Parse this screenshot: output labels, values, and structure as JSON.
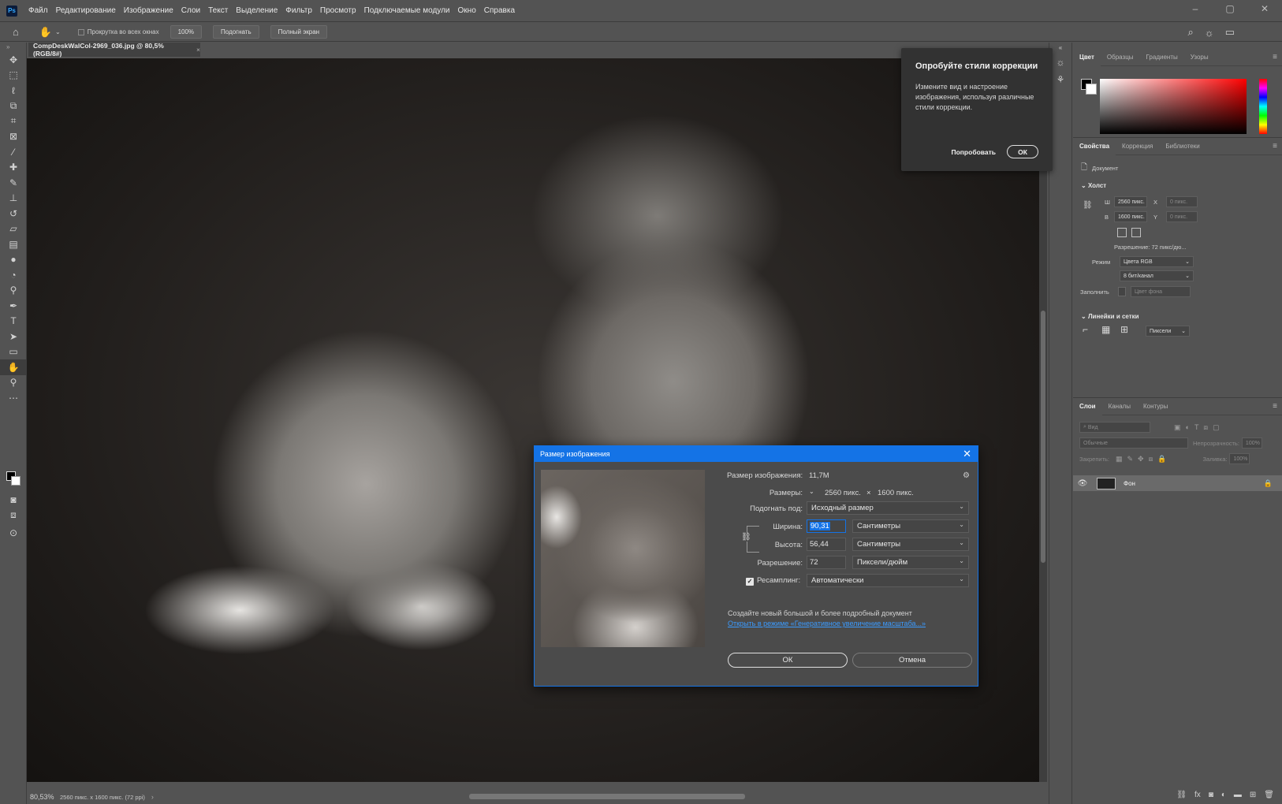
{
  "app": {
    "logo": "Ps"
  },
  "menu": [
    "Файл",
    "Редактирование",
    "Изображение",
    "Слои",
    "Текст",
    "Выделение",
    "Фильтр",
    "Просмотр",
    "Подключаемые модули",
    "Окно",
    "Справка"
  ],
  "options": {
    "scroll_all_label": "Прокрутка во всех окнах",
    "zoom_btn": "100%",
    "fit_btn": "Подогнать",
    "fullscreen_btn": "Полный экран"
  },
  "document": {
    "tab_title": "CompDeskWalCol-2969_036.jpg @ 80,5% (RGB/8#)",
    "zoom": "80,53%",
    "info": "2560 пикс. x 1600 пикс. (72 ppi)"
  },
  "tip": {
    "title": "Опробуйте стили коррекции",
    "body": "Измените вид и настроение изображения, используя различные стили коррекции.",
    "try_label": "Попробовать",
    "ok_label": "ОК"
  },
  "color_panel": {
    "tabs": [
      "Цвет",
      "Образцы",
      "Градиенты",
      "Узоры"
    ],
    "fg": "#000000",
    "bg": "#ffffff"
  },
  "properties_panel": {
    "tabs": [
      "Свойства",
      "Коррекция",
      "Библиотеки"
    ],
    "doc_label": "Документ",
    "canvas_header": "Холст",
    "w_label": "Ш",
    "w_value": "2560 пикс.",
    "h_label": "В",
    "h_value": "1600 пикс.",
    "x_label": "X",
    "x_placeholder": "0 пикс.",
    "y_label": "Y",
    "y_placeholder": "0 пикс.",
    "resolution": "Разрешение: 72 пикс/дю...",
    "mode_label": "Режим",
    "mode_value": "Цвета RGB",
    "bits_value": "8 бит/канал",
    "fill_label": "Заполнить",
    "fill_value": "Цвет фона",
    "rulers_header": "Линейки и сетки",
    "units_value": "Пиксели"
  },
  "layers_panel": {
    "tabs": [
      "Слои",
      "Каналы",
      "Контуры"
    ],
    "search_placeholder": "Вид",
    "blend_mode": "Обычные",
    "opacity_label": "Непрозрачность:",
    "opacity_value": "100%",
    "lock_label": "Закрепить:",
    "fill_label": "Заливка:",
    "fill_value": "100%",
    "layer_name": "Фон"
  },
  "dialog": {
    "title": "Размер изображения",
    "size_label": "Размер изображения:",
    "size_value": "11,7M",
    "dims_label": "Размеры:",
    "dims_w": "2560 пикс.",
    "dims_x": "×",
    "dims_h": "1600 пикс.",
    "fit_label": "Подогнать под:",
    "fit_value": "Исходный размер",
    "width_label": "Ширина:",
    "width_value": "90,31",
    "width_unit": "Сантиметры",
    "height_label": "Высота:",
    "height_value": "56,44",
    "height_unit": "Сантиметры",
    "res_label": "Разрешение:",
    "res_value": "72",
    "res_unit": "Пиксели/дюйм",
    "resample_label": "Ресамплинг:",
    "resample_value": "Автоматически",
    "gen_text": "Создайте новый большой и более подробный документ",
    "gen_link": "Открыть в режиме «Генеративное увеличение масштаба...»",
    "ok_label": "ОК",
    "cancel_label": "Отмена"
  }
}
